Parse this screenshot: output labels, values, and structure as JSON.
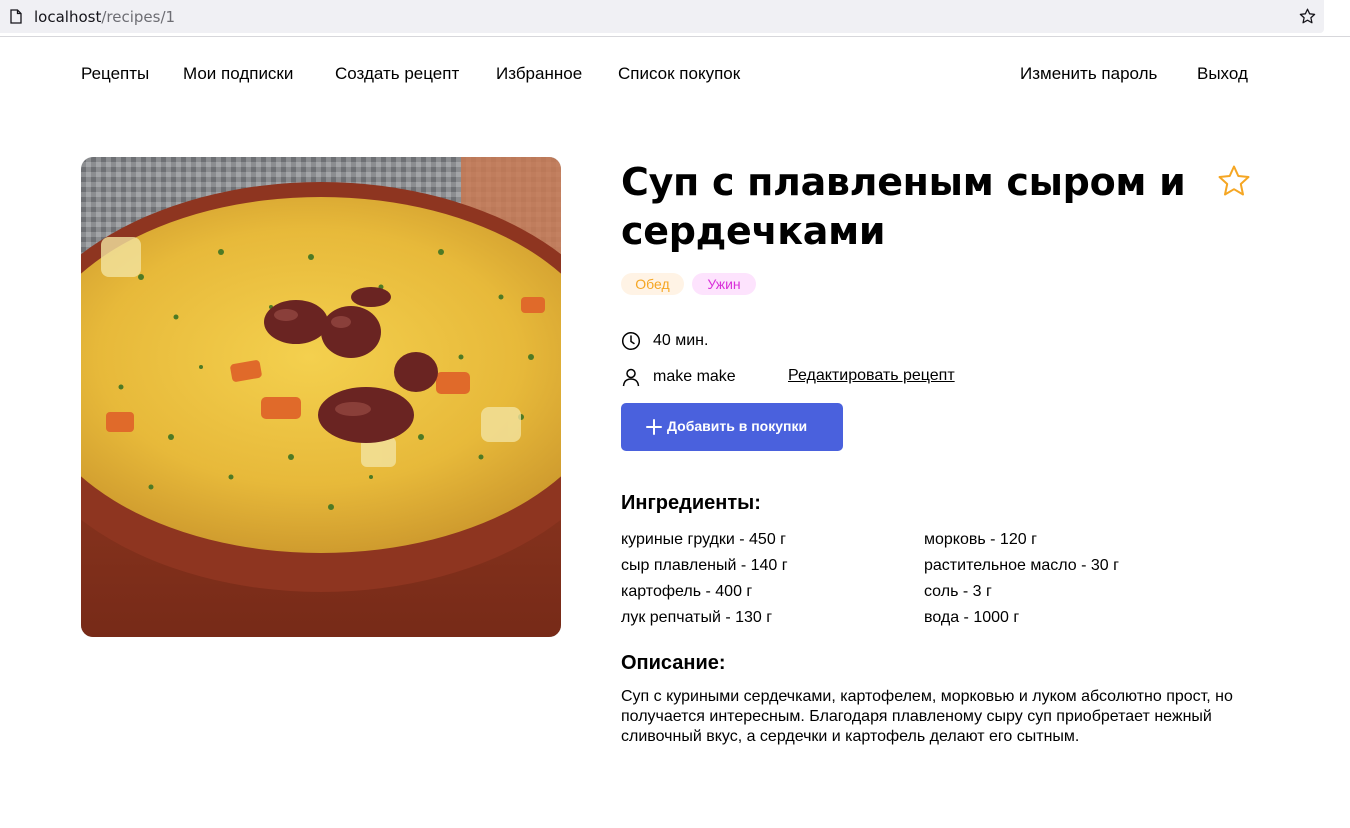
{
  "browser": {
    "url_host": "localhost",
    "url_path": "/recipes/1"
  },
  "nav": {
    "left": [
      "Рецепты",
      "Мои подписки",
      "Создать рецепт",
      "Избранное",
      "Список покупок"
    ],
    "right": [
      "Изменить пароль",
      "Выход"
    ]
  },
  "recipe": {
    "title": "Суп с плавленым сыром и сердечками",
    "tags": [
      {
        "label": "Обед",
        "color": "#f5a623",
        "bg": "#fff3e5"
      },
      {
        "label": "Ужин",
        "color": "#d931d9",
        "bg": "#fde3fd"
      }
    ],
    "cook_time": "40 мин.",
    "author": "make make",
    "edit_label": "Редактировать рецепт",
    "add_to_cart_label": "Добавить в покупки",
    "ingredients_heading": "Ингредиенты:",
    "ingredients_left": [
      "куриные грудки - 450 г",
      "сыр плавленый - 140 г",
      "картофель - 400 г",
      "лук репчатый - 130 г"
    ],
    "ingredients_right": [
      "морковь - 120 г",
      "растительное масло - 30 г",
      "соль - 3 г",
      "вода - 1000 г"
    ],
    "description_heading": "Описание:",
    "description": "Суп с куриными сердечками, картофелем, морковью и луком абсолютно прост, но получается интересным. Благодаря плавленому сыру суп приобретает нежный сливочный вкус, а сердечки и картофель делают его сытным."
  },
  "colors": {
    "accent": "#4a61dd",
    "favorite_star": "#f5a623"
  },
  "icons": {
    "page": "page-icon",
    "bookmark": "bookmark-star-icon",
    "favorite": "favorite-star-icon",
    "time": "clock-icon",
    "author": "user-icon",
    "add": "plus-icon"
  }
}
